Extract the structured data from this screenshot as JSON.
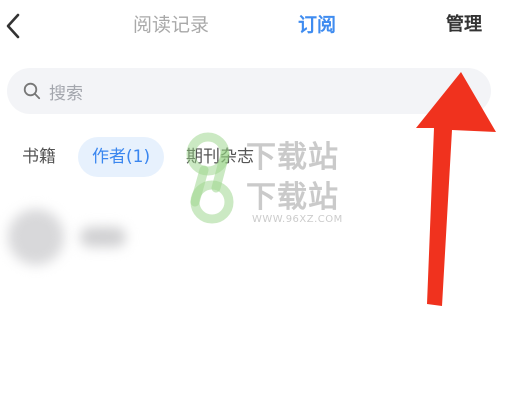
{
  "topbar": {
    "tabs": [
      {
        "label": "阅读记录"
      },
      {
        "label": "订阅"
      }
    ],
    "manage_label": "管理"
  },
  "search": {
    "placeholder": "搜索"
  },
  "filters": [
    {
      "label": "书籍"
    },
    {
      "label": "作者(1)"
    },
    {
      "label": "期刊杂志"
    }
  ],
  "watermark": {
    "text_line1": "下载站",
    "text_line2": "下载站",
    "url": "WWW.96XZ.COM"
  },
  "colors": {
    "accent": "#3f8cf0",
    "arrow": "#f0321e",
    "search_bg": "#f3f4f7",
    "chip_bg": "#e7f1fd"
  },
  "icons": [
    "back-arrow-icon",
    "search-icon"
  ]
}
